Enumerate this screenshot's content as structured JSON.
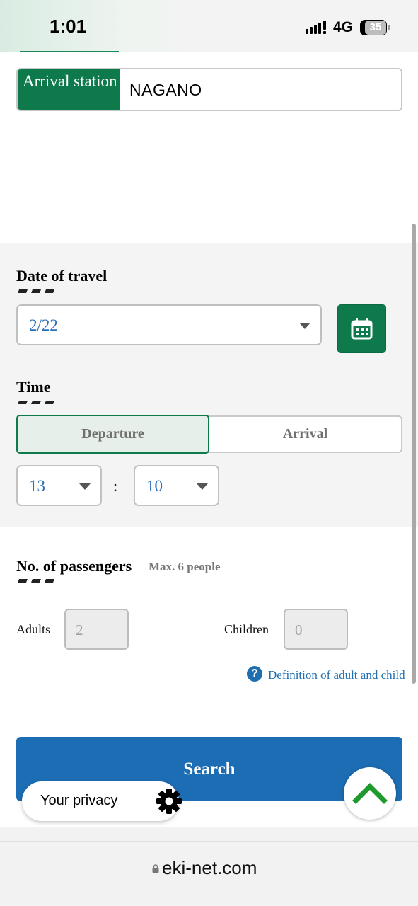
{
  "status_bar": {
    "time": "1:01",
    "network": "4G",
    "battery": "35"
  },
  "arrival": {
    "label": "Arrival station",
    "value": "NAGANO"
  },
  "date_of_travel": {
    "title": "Date of travel",
    "selected": "2/22",
    "calendar_icon": "calendar-icon"
  },
  "time": {
    "title": "Time",
    "modes": [
      "Departure",
      "Arrival"
    ],
    "selected_mode": "Departure",
    "hour": "13",
    "separator": ":",
    "minute": "10"
  },
  "passengers": {
    "title": "No. of passengers",
    "max_note": "Max. 6 people",
    "adults_label": "Adults",
    "adults_value": "2",
    "children_label": "Children",
    "children_value": "0",
    "definition_link": "Definition of adult and child"
  },
  "search": {
    "label": "Search"
  },
  "privacy": {
    "label": "Your privacy"
  },
  "browser": {
    "url": "eki-net.com"
  },
  "colors": {
    "brand_green": "#0e7a4c",
    "search_blue": "#1c6db3",
    "link_blue": "#1f6fb0",
    "back_to_top_green": "#1e9a2c"
  }
}
